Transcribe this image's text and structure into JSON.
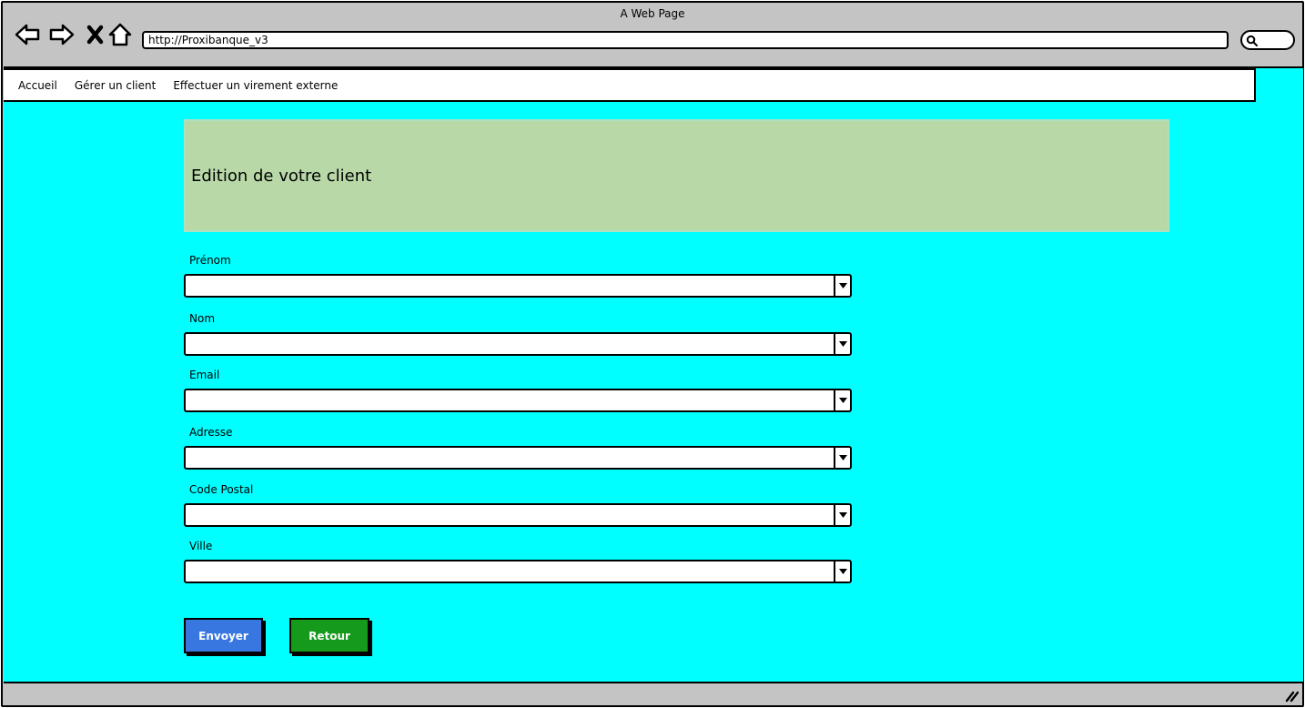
{
  "window": {
    "title": "A Web Page"
  },
  "toolbar": {
    "icons": [
      "back-arrow-icon",
      "forward-arrow-icon",
      "close-x-icon",
      "home-icon"
    ],
    "url": "http://Proxibanque_v3",
    "search_icon": "search-icon"
  },
  "menu": {
    "items": [
      {
        "label": "Accueil"
      },
      {
        "label": "Gérer un client"
      },
      {
        "label": "Effectuer un virement externe"
      }
    ]
  },
  "header": {
    "title": "Edition de votre client",
    "background": "#b8d8a8"
  },
  "form": {
    "fields": [
      {
        "label": "Prénom",
        "value": ""
      },
      {
        "label": "Nom",
        "value": ""
      },
      {
        "label": "Email",
        "value": ""
      },
      {
        "label": "Adresse",
        "value": ""
      },
      {
        "label": "Code Postal",
        "value": ""
      },
      {
        "label": "Ville",
        "value": ""
      }
    ],
    "submit_label": "Envoyer",
    "back_label": "Retour"
  },
  "colors": {
    "page_background": "#00ffff",
    "submit_button": "#3877e0",
    "back_button": "#159a1c",
    "chrome": "#c4c4c4"
  }
}
